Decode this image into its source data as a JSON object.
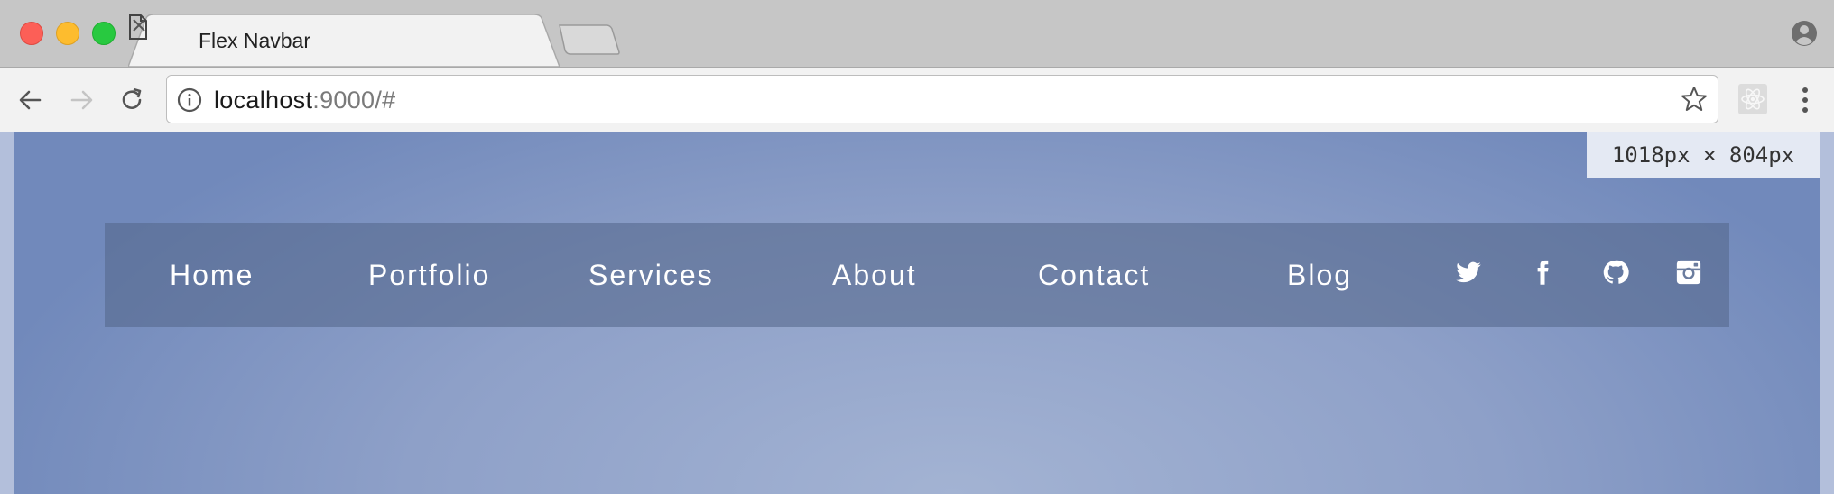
{
  "browser": {
    "tab": {
      "title": "Flex Navbar"
    },
    "address_bar": {
      "host": "localhost",
      "rest": ":9000/#"
    }
  },
  "viewport": {
    "dimensions_badge": "1018px × 804px"
  },
  "navbar": {
    "links": [
      {
        "label": "Home"
      },
      {
        "label": "Portfolio"
      },
      {
        "label": "Services"
      },
      {
        "label": "About"
      },
      {
        "label": "Contact"
      },
      {
        "label": "Blog"
      }
    ],
    "social_icons": [
      "twitter-icon",
      "facebook-icon",
      "github-icon",
      "instagram-icon"
    ]
  },
  "colors": {
    "page_gradient_center": "#a3b3d3",
    "page_gradient_edge": "#7189bb",
    "navbar_bg": "rgba(84,104,140,0.58)",
    "link_color": "#ffffff"
  }
}
